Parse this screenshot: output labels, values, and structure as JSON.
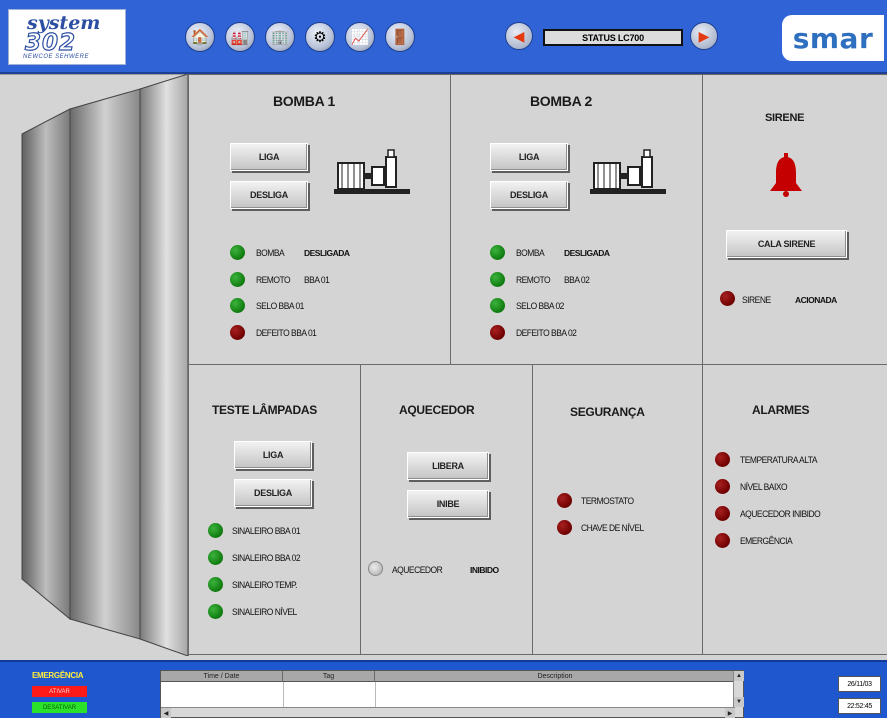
{
  "header": {
    "logo_left": {
      "line1": "system",
      "line2": "302",
      "line3": "NEWCOE SEHWERE"
    },
    "nav_buttons": [
      {
        "icon": "home-icon",
        "glyph": "🏠"
      },
      {
        "icon": "factory-icon",
        "glyph": "🏭"
      },
      {
        "icon": "building-icon",
        "glyph": "🏢"
      },
      {
        "icon": "gear-icon",
        "glyph": "⚙"
      },
      {
        "icon": "chart-icon",
        "glyph": "📈"
      },
      {
        "icon": "door-icon",
        "glyph": "🚪"
      }
    ],
    "prev_glyph": "◀",
    "next_glyph": "▶",
    "status_label": "STATUS LC700",
    "logo_right": "smar"
  },
  "bomba1": {
    "title": "BOMBA 1",
    "liga": "LIGA",
    "desliga": "DESLIGA",
    "indicators": [
      {
        "label": "BOMBA",
        "value": "DESLIGADA",
        "color": "green"
      },
      {
        "label": "REMOTO",
        "value": "BBA 01",
        "color": "green"
      },
      {
        "label": "SELO BBA 01",
        "value": "",
        "color": "green"
      },
      {
        "label": "DEFEITO BBA 01",
        "value": "",
        "color": "red"
      }
    ]
  },
  "bomba2": {
    "title": "BOMBA 2",
    "liga": "LIGA",
    "desliga": "DESLIGA",
    "indicators": [
      {
        "label": "BOMBA",
        "value": "DESLIGADA",
        "color": "green"
      },
      {
        "label": "REMOTO",
        "value": "BBA 02",
        "color": "green"
      },
      {
        "label": "SELO BBA 02",
        "value": "",
        "color": "green"
      },
      {
        "label": "DEFEITO BBA 02",
        "value": "",
        "color": "red"
      }
    ]
  },
  "sirene": {
    "title": "SIRENE",
    "button": "CALA SIRENE",
    "indicator": {
      "label": "SIRENE",
      "value": "ACIONADA",
      "color": "red"
    }
  },
  "teste": {
    "title": "TESTE LÂMPADAS",
    "liga": "LIGA",
    "desliga": "DESLIGA",
    "indicators": [
      {
        "label": "SINALEIRO BBA 01",
        "color": "green"
      },
      {
        "label": "SINALEIRO BBA 02",
        "color": "green"
      },
      {
        "label": "SINALEIRO TEMP.",
        "color": "green"
      },
      {
        "label": "SINALEIRO NÍVEL",
        "color": "green"
      }
    ]
  },
  "aquecedor": {
    "title": "AQUECEDOR",
    "libera": "LIBERA",
    "inibe": "INIBE",
    "indicator": {
      "label": "AQUECEDOR",
      "value": "INIBIDO",
      "color": "off"
    }
  },
  "seguranca": {
    "title": "SEGURANÇA",
    "indicators": [
      {
        "label": "TERMOSTATO",
        "color": "red"
      },
      {
        "label": "CHAVE DE NÍVEL",
        "color": "red"
      }
    ]
  },
  "alarmes": {
    "title": "ALARMES",
    "indicators": [
      {
        "label": "TEMPERATURA ALTA",
        "color": "red"
      },
      {
        "label": "NÍVEL BAIXO",
        "color": "red"
      },
      {
        "label": "AQUECEDOR INIBIDO",
        "color": "red"
      },
      {
        "label": "EMERGÊNCIA",
        "color": "red"
      }
    ]
  },
  "footer": {
    "emergencia_title": "EMERGÊNCIA",
    "emergencia_on": "ATIVAR",
    "emergencia_off": "DESATIVAR",
    "table_headers": [
      "Time / Date",
      "Tag",
      "Description"
    ],
    "date": "26/11/03",
    "time": "22:52:45"
  },
  "colors": {
    "header_blue": "#2f63d6",
    "indicator_green": "#0e7a0e",
    "indicator_red": "#6e0000",
    "bell_red": "#c40000"
  }
}
